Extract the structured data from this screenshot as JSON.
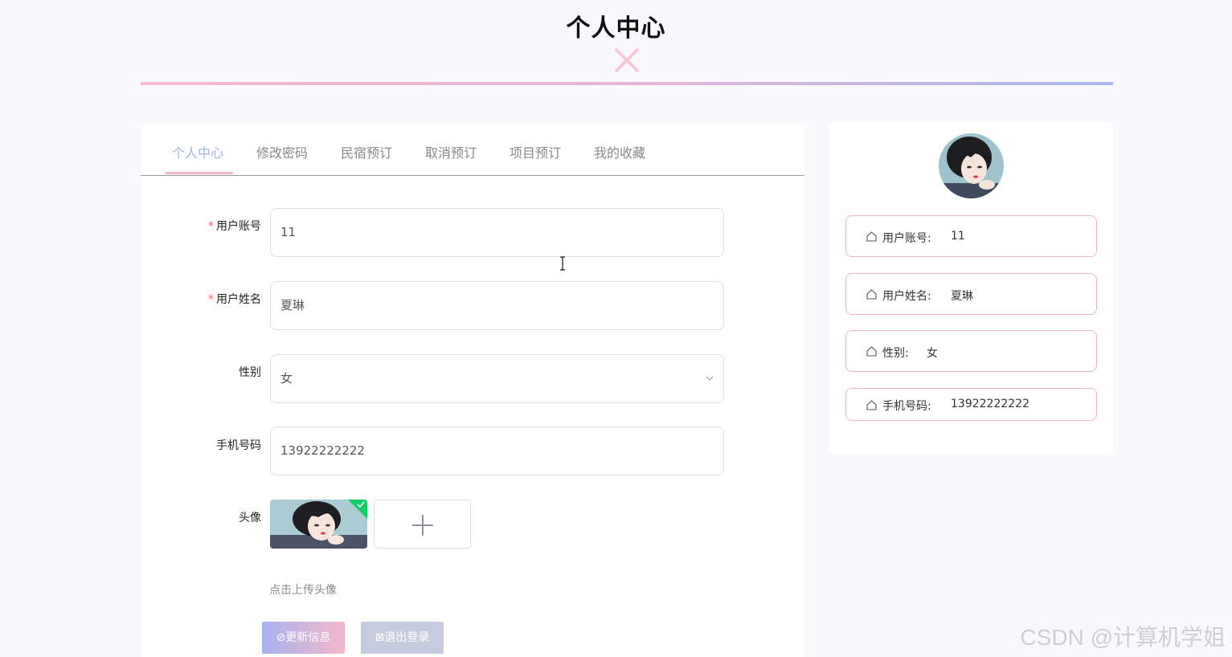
{
  "page": {
    "title": "个人中心"
  },
  "tabs": [
    "个人中心",
    "修改密码",
    "民宿预订",
    "取消预订",
    "项目预订",
    "我的收藏"
  ],
  "form": {
    "account_label": "用户账号",
    "account_value": "11",
    "name_label": "用户姓名",
    "name_value": "夏琳",
    "gender_label": "性别",
    "gender_value": "女",
    "phone_label": "手机号码",
    "phone_value": "13922222222",
    "avatar_label": "头像",
    "upload_hint": "点击上传头像",
    "required_mark": "*"
  },
  "buttons": {
    "update": "更新信息",
    "logout": "退出登录"
  },
  "profile": {
    "rows": [
      {
        "label": "用户账号:",
        "value": "11"
      },
      {
        "label": "用户姓名:",
        "value": "夏琳"
      },
      {
        "label": "性别:",
        "value": "女"
      },
      {
        "label": "手机号码:",
        "value": "13922222222"
      }
    ]
  },
  "watermark": "CSDN @计算机学姐",
  "colors": {
    "accent_pink": "#f3b4c6",
    "accent_blue": "#a8b8f2",
    "active_tab": "#9fb3e8",
    "success_green": "#13ce66"
  },
  "icons": {
    "deco": "close-x-icon",
    "row": "home-icon",
    "select": "chevron-down-icon",
    "upload": "plus-icon",
    "success": "check-icon"
  }
}
